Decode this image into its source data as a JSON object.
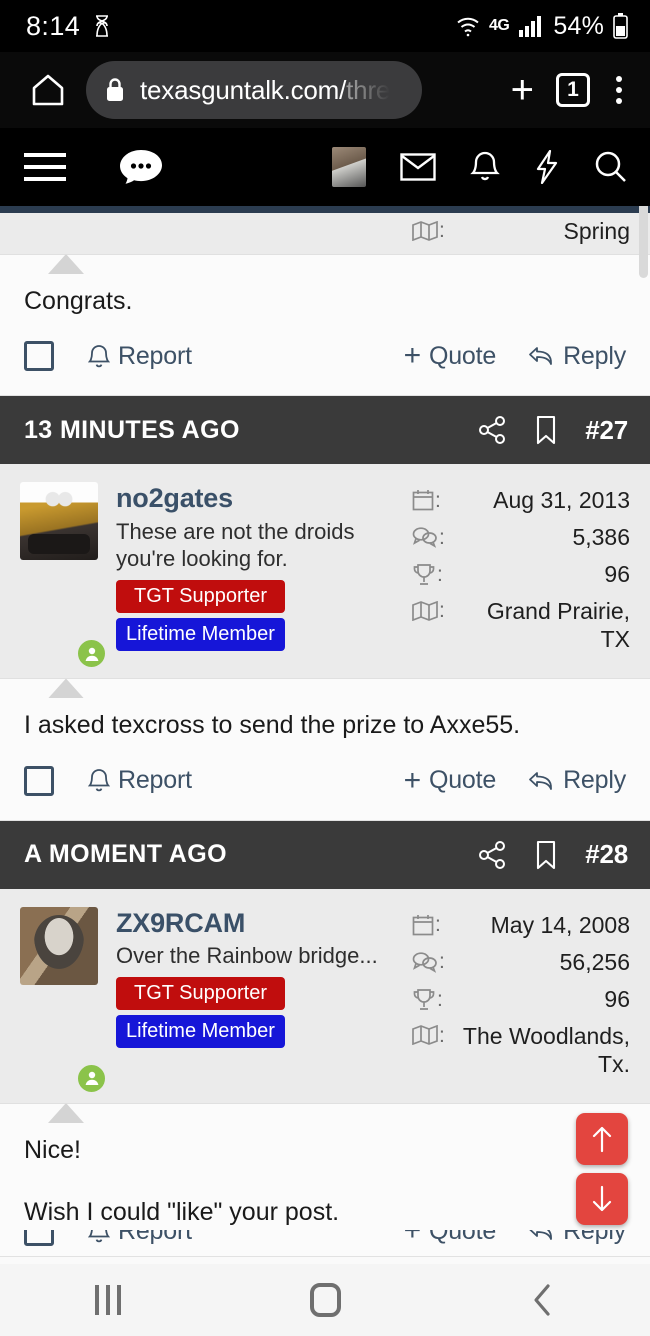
{
  "status_bar": {
    "time": "8:14",
    "hourglass_icon": "hourglass-icon",
    "wifi_icon": "wifi-icon",
    "network_type": "4G",
    "signal_icon": "signal-bars-icon",
    "battery_percent": "54%",
    "battery_icon": "battery-icon"
  },
  "browser": {
    "home_icon": "home-icon",
    "lock_icon": "lock-icon",
    "url_visible": "texasguntalk.com/",
    "url_faded": "thre",
    "new_tab_icon": "plus-icon",
    "tab_count": "1",
    "menu_icon": "kebab-menu-icon"
  },
  "forum_nav": {
    "menu_icon": "hamburger-icon",
    "chat_icon": "chat-bubble-icon",
    "avatar_icon": "user-avatar-thumbnail",
    "inbox_icon": "envelope-icon",
    "alerts_icon": "bell-icon",
    "whats_new_icon": "lightning-bolt-icon",
    "search_icon": "search-icon"
  },
  "clipped_top_post": {
    "location_icon": "map-icon",
    "location": "Spring",
    "body": "Congrats.",
    "actions": {
      "checkbox": "select-post-checkbox",
      "report_icon": "bell-icon",
      "report": "Report",
      "quote_plus": "+",
      "quote": "Quote",
      "reply_icon": "reply-arrow-icon",
      "reply": "Reply"
    }
  },
  "posts": [
    {
      "timestamp": "13 MINUTES AGO",
      "share_icon": "share-icon",
      "bookmark_icon": "bookmark-icon",
      "number": "#27",
      "user": {
        "name": "no2gates",
        "title": "These are not the droids you're looking for.",
        "avatar_icon": "walle-avatar",
        "online_icon": "online-status-icon",
        "badges": [
          "TGT Supporter",
          "Lifetime Member"
        ]
      },
      "stats": [
        {
          "icon": "calendar-icon",
          "value": "Aug 31, 2013"
        },
        {
          "icon": "messages-icon",
          "value": "5,386"
        },
        {
          "icon": "trophy-icon",
          "value": "96"
        },
        {
          "icon": "map-icon",
          "value": "Grand Prairie, TX"
        }
      ],
      "body": "I asked texcross to send the prize to Axxe55.",
      "actions": {
        "checkbox": "select-post-checkbox",
        "report_icon": "bell-icon",
        "report": "Report",
        "quote_plus": "+",
        "quote": "Quote",
        "reply_icon": "reply-arrow-icon",
        "reply": "Reply"
      }
    },
    {
      "timestamp": "A MOMENT AGO",
      "share_icon": "share-icon",
      "bookmark_icon": "bookmark-icon",
      "number": "#28",
      "user": {
        "name": "ZX9RCAM",
        "title": "Over the Rainbow bridge...",
        "avatar_icon": "dog-avatar",
        "online_icon": "online-status-icon",
        "badges": [
          "TGT Supporter",
          "Lifetime Member"
        ]
      },
      "stats": [
        {
          "icon": "calendar-icon",
          "value": "May 14, 2008"
        },
        {
          "icon": "messages-icon",
          "value": "56,256"
        },
        {
          "icon": "trophy-icon",
          "value": "96"
        },
        {
          "icon": "map-icon",
          "value": "The Woodlands, Tx."
        }
      ],
      "body_line1": "Nice!",
      "body_line2": "Wish I could \"like\" your post.",
      "actions": {
        "checkbox": "select-post-checkbox",
        "report_icon": "bell-icon",
        "report": "Report",
        "quote_plus": "+",
        "quote": "Quote",
        "reply_icon": "reply-arrow-icon",
        "reply": "Reply"
      }
    }
  ],
  "scroll_buttons": {
    "up_icon": "arrow-up-icon",
    "down_icon": "arrow-down-icon",
    "color": "#e3453f"
  },
  "android_nav": {
    "recents_icon": "recents-icon",
    "home_icon": "home-circle-icon",
    "back_icon": "back-chevron-icon"
  },
  "colors": {
    "badge_red": "#c00d0d",
    "badge_blue": "#1616d8",
    "username": "#3a5068",
    "post_header": "#3a3a3a",
    "online_green": "#8bc34a"
  }
}
